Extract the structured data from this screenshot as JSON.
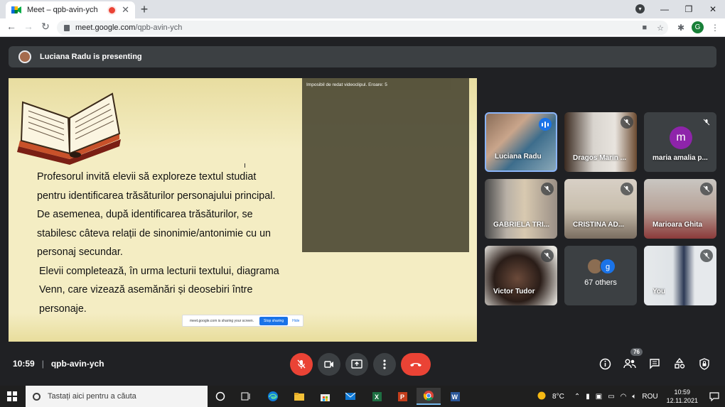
{
  "browser": {
    "tab_title": "Meet – qpb-avin-ych",
    "url_domain": "meet.google.com",
    "url_path": "/qpb-avin-ych",
    "profile_initial": "G",
    "accent": "#1a73e8"
  },
  "meet": {
    "presenting_text": "Luciana Radu is presenting",
    "slide": {
      "lines": [
        "Profesorul invită elevii să exploreze textul studiat",
        "pentru identificarea trăsăturilor personajului principal.",
        "De asemenea, după identificarea trăsăturilor, se",
        "stabilesc câteva relații de sinonimie/antonimie cu un",
        "personaj secundar."
      ],
      "lines2": [
        "Elevii completează, în urma lecturii textului, diagrama",
        "Venn, care vizează asemănări și deosebiri între",
        "personaje."
      ],
      "video_error": "Imposibil de redat videoclipul. Eroare: 5",
      "share_banner_text": "meet.google.com is sharing your screen.",
      "share_stop": "Stop sharing",
      "share_hide": "Hide"
    },
    "participants": [
      {
        "name": "Luciana Radu",
        "state": "speaking"
      },
      {
        "name": "Dragos Marin ...",
        "state": "muted"
      },
      {
        "name": "maria amalia p...",
        "state": "muted",
        "avatar_letter": "m"
      },
      {
        "name": "GABRIELA TRI...",
        "state": "muted"
      },
      {
        "name": "CRISTINA AD...",
        "state": "muted"
      },
      {
        "name": "Marioara Ghita",
        "state": "muted"
      },
      {
        "name": "Victor Tudor",
        "state": "muted"
      },
      {
        "name": "67 others",
        "state": "group",
        "avatar_letter": "g"
      },
      {
        "name": "You",
        "state": "muted"
      }
    ],
    "bottom": {
      "time": "10:59",
      "meeting_code": "qpb-avin-ych",
      "people_count": "76"
    }
  },
  "taskbar": {
    "search_placeholder": "Tastați aici pentru a căuta",
    "weather": "8°C",
    "lang": "ROU",
    "clock_time": "10:59",
    "clock_date": "12.11.2021"
  }
}
